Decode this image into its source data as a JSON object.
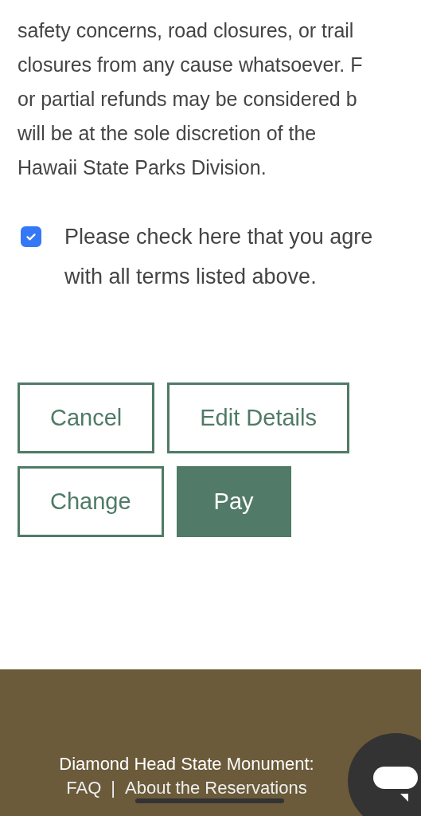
{
  "terms": {
    "lines": [
      "safety concerns, road closures, or trail",
      "closures from any cause whatsoever. F",
      "or partial refunds may be considered b",
      "will be at the sole discretion of the",
      "Hawaii State Parks Division."
    ]
  },
  "agreement": {
    "checked": true,
    "lines": [
      "Please check here that you agre",
      "with all terms listed above."
    ]
  },
  "buttons": [
    {
      "label": "Cancel",
      "kind": "outline"
    },
    {
      "label": "Edit Details",
      "kind": "outline"
    },
    {
      "label": "Change",
      "kind": "outline"
    },
    {
      "label": "Pay",
      "kind": "primary"
    }
  ],
  "footer": {
    "title": "Diamond Head State Monument:",
    "links": [
      "FAQ",
      "About the Reservations"
    ],
    "separator": "|"
  }
}
